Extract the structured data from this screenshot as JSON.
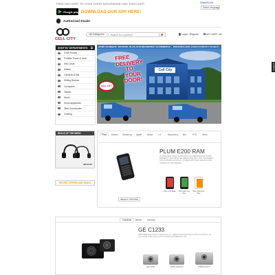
{
  "topbar": {
    "free_shipping": "FREE DELIVERY TO YOUR DOOR NATIONWIDE! ANY DISCOUNT!",
    "weblink": "WantALink",
    "language": "Select Language"
  },
  "app_promo": {
    "store_badge": "Google play",
    "download_text": "DOWNLOAD OUR APP HERE!"
  },
  "authorized": {
    "label": "Authorized Dealer"
  },
  "logo": {
    "text": "CELL CITY"
  },
  "search": {
    "category": "All Categories",
    "placeholder": "Search for a product"
  },
  "account": {
    "login": "Login / Register"
  },
  "cart": {
    "label": "MY CART / $0"
  },
  "sidebar": {
    "title": "SHOP BY DEPARTMENTS",
    "items": [
      {
        "label": "GSM Phones"
      },
      {
        "label": "Portable Power & Juice"
      },
      {
        "label": "SIM Cards"
      },
      {
        "label": "Airtime"
      },
      {
        "label": "Cameras & Kits"
      },
      {
        "label": "Writing Devices"
      },
      {
        "label": "Computers"
      },
      {
        "label": "Tablets"
      },
      {
        "label": "Music"
      },
      {
        "label": "Home Appliances"
      },
      {
        "label": "Other Accessories"
      },
      {
        "label": "Clothing"
      }
    ]
  },
  "nav": {
    "items": [
      "HOME PAGE",
      "SHOP",
      "REVIEWS",
      "BLOG",
      "OUR BRANDS",
      "WHY ECOMMERCE",
      "PERSONALIZED CASES",
      "CONTACT US",
      "HELP"
    ]
  },
  "banner": {
    "headline_1": "FREE",
    "headline_2": "DELIVERY",
    "headline_3": "TO",
    "headline_4": "YOUR",
    "headline_5": "DOOR!",
    "store_sign": "Cell City",
    "sign_badge": "CELL CITY"
  },
  "deals": {
    "title": "DEALS OF THE WEEK",
    "brand": "iBlueCell"
  },
  "recent_offers": {
    "label": "RECENT OFFERS AND DEALS"
  },
  "brand_tabs": [
    "Plum",
    "Alcatel",
    "Samsung",
    "Apple",
    "Nokia",
    "LG",
    "Blackberry",
    "Blu",
    "HTC",
    "Orbic"
  ],
  "product1": {
    "title": "PLUM E200 RAM",
    "description": "3G DESIGNING. PLUM TECHNOLOGY IS A NEW BRAND WITH HIGH DURABILITY AND IMPROVED MEMORY BATTERY LIFE. IT'S PERFECT FOR OUTDOOR ACTIVITIES, IT COMES WITH DUAL SIM AND GOOD LOOKING ON THE SCREEN.",
    "button": "SELECT OPTIONS",
    "variants": [
      {
        "label": "Plum X PA Black",
        "color": "#e53935"
      },
      {
        "label": "Plum Z101 Axe Plus",
        "color": "#43a047"
      },
      {
        "label": "Plum Z100 Plus Plus",
        "color": "#fb8c00"
      }
    ]
  },
  "cat_tabs": [
    "Cameras",
    "Tablets",
    "Gaming"
  ],
  "product2": {
    "title": "GE C1233",
    "description": "12MP digital camera with 3x optical zoom, 2.7\" digital LCD and auto features with face detection, red eye removal, 3 GB memory and CYCLOSUS TECHNOLOGY LTD.",
    "variants": [
      {
        "label": "GE J1470S"
      },
      {
        "label": "NIKON COOLPIX"
      },
      {
        "label": "SAMSUNG ST77"
      }
    ]
  },
  "feedback": {
    "label": "Feedback"
  }
}
